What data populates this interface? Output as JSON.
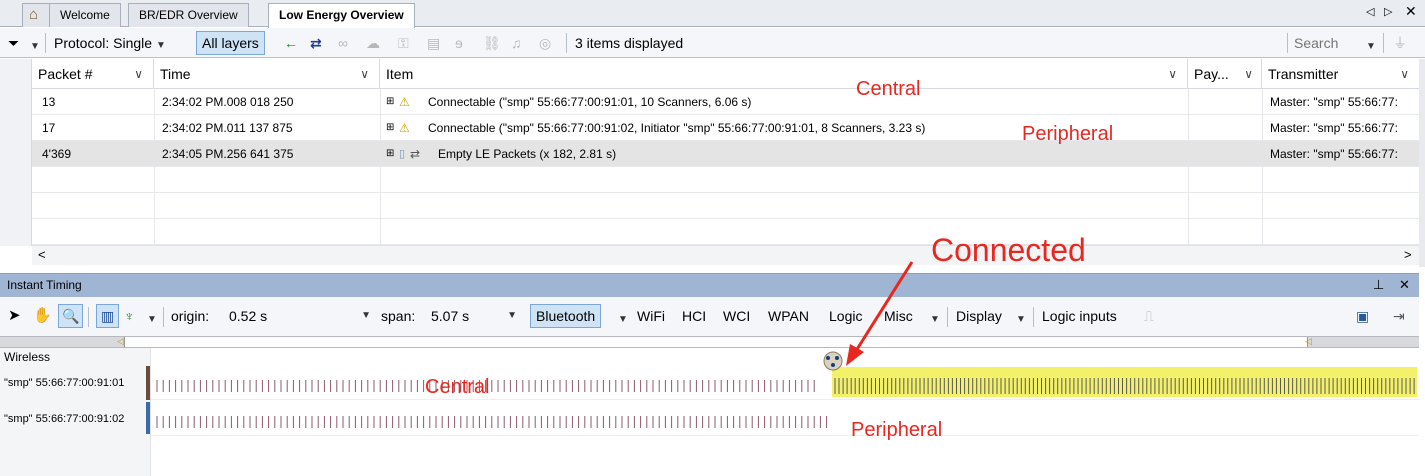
{
  "tabs": {
    "welcome": "Welcome",
    "bredr": "BR/EDR Overview",
    "le": "Low Energy Overview"
  },
  "toolbar": {
    "protocol_label": "Protocol: Single",
    "all_layers": "All layers",
    "items_displayed": "3 items displayed",
    "search_placeholder": "Search"
  },
  "grid": {
    "columns": [
      "Packet #",
      "Time",
      "Item",
      "Pay...",
      "Transmitter"
    ],
    "rows": [
      {
        "packet": "13",
        "time": "2:34:02 PM.008 018 250",
        "item": "Connectable (\"smp\" 55:66:77:00:91:01, 10 Scanners, 6.06 s)",
        "transmitter": "Master: \"smp\" 55:66:77:"
      },
      {
        "packet": "17",
        "time": "2:34:02 PM.011 137 875",
        "item": "Connectable (\"smp\" 55:66:77:00:91:02, Initiator \"smp\" 55:66:77:00:91:01, 8 Scanners, 3.23 s)",
        "transmitter": "Master: \"smp\" 55:66:77:"
      },
      {
        "packet": "4'369",
        "time": "2:34:05 PM.256 641 375",
        "item": "Empty LE Packets (x 182, 2.81 s)",
        "transmitter": "Master: \"smp\" 55:66:77:"
      }
    ]
  },
  "instant_timing": {
    "title": "Instant Timing",
    "origin_label": "origin:",
    "origin_value": "0.52 s",
    "span_label": "span:",
    "span_value": "5.07 s",
    "menus": [
      "Bluetooth",
      "WiFi",
      "HCI",
      "WCI",
      "WPAN",
      "Logic",
      "Misc",
      "Display",
      "Logic inputs"
    ],
    "group_label": "Wireless",
    "tracks": [
      "\"smp\" 55:66:77:00:91:01",
      "\"smp\" 55:66:77:00:91:02"
    ]
  },
  "annotations": {
    "central_top": "Central",
    "peripheral_top": "Peripheral",
    "connected": "Connected",
    "central_track": "Central",
    "peripheral_track": "Peripheral"
  },
  "colors": {
    "annotation": "#e8281f",
    "connected_highlight": "#f3f06a",
    "tick": "#8c5a6a",
    "panel_header": "#9fb5d3"
  }
}
